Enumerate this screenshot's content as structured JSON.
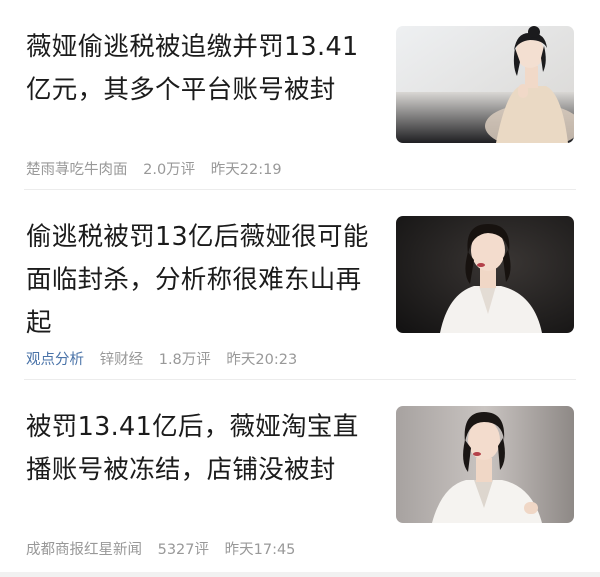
{
  "news": [
    {
      "title": "薇娅偷逃税被追缴并罚13.41亿元，其多个平台账号被封",
      "tag": "",
      "source": "楚雨荨吃牛肉面",
      "comments": "2.0万评",
      "time": "昨天22:19",
      "thumbnail_icon": "photo-woman-white-backdrop"
    },
    {
      "title": "偷逃税被罚13亿后薇娅很可能面临封杀，分析称很难东山再起",
      "tag": "观点分析",
      "source": "锌财经",
      "comments": "1.8万评",
      "time": "昨天20:23",
      "thumbnail_icon": "photo-woman-dark-backdrop"
    },
    {
      "title": "被罚13.41亿后，薇娅淘宝直播账号被冻结，店铺没被封",
      "tag": "",
      "source": "成都商报红星新闻",
      "comments": "5327评",
      "time": "昨天17:45",
      "thumbnail_icon": "photo-woman-grey-backdrop"
    }
  ],
  "colors": {
    "title": "#1b1b1b",
    "meta": "#999999",
    "tag": "#4a73a8",
    "divider": "#ececec"
  }
}
